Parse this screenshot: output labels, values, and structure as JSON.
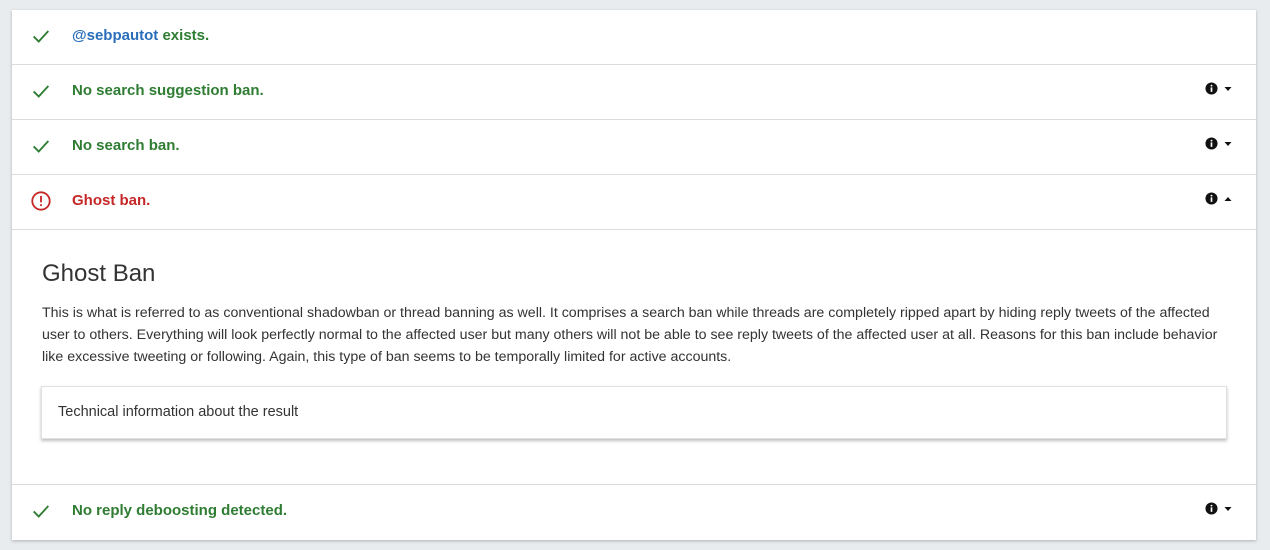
{
  "checks": [
    {
      "status": "ok",
      "handle": "@sebpautot",
      "text": " exists."
    },
    {
      "status": "ok",
      "text": "No search suggestion ban."
    },
    {
      "status": "ok",
      "text": "No search ban."
    },
    {
      "status": "error",
      "text": "Ghost ban.",
      "expanded": true
    },
    {
      "status": "ok",
      "text": "No reply deboosting detected."
    }
  ],
  "details": {
    "title": "Ghost Ban",
    "body": "This is what is referred to as conventional shadowban or thread banning as well. It comprises a search ban while threads are completely ripped apart by hiding reply tweets of the affected user to others. Everything will look perfectly normal to the affected user but many others will not be able to see reply tweets of the affected user at all. Reasons for this ban include behavior like excessive tweeting or following. Again, this type of ban seems to be temporally limited for active accounts.",
    "technical_label": "Technical information about the result"
  },
  "colors": {
    "ok": "#2e7d32",
    "error": "#c62828",
    "handle": "#2a6ebb"
  },
  "icons": {
    "ok": "check-icon",
    "error": "alert-circle-icon",
    "info": "info-icon",
    "expand": "caret-down-icon",
    "collapse": "caret-up-icon"
  }
}
